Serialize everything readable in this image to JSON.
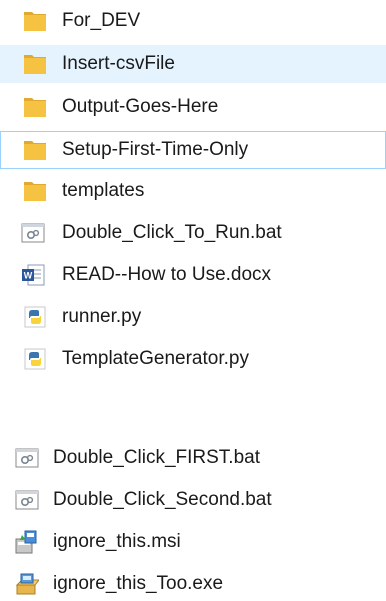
{
  "group1": {
    "items": [
      {
        "label": "For_DEV",
        "icon": "folder-icon"
      },
      {
        "label": "Insert-csvFile",
        "icon": "folder-icon"
      },
      {
        "label": "Output-Goes-Here",
        "icon": "folder-icon"
      },
      {
        "label": "Setup-First-Time-Only",
        "icon": "folder-icon"
      },
      {
        "label": "templates",
        "icon": "folder-icon"
      },
      {
        "label": "Double_Click_To_Run.bat",
        "icon": "batch-file-icon"
      },
      {
        "label": "READ--How to Use.docx",
        "icon": "word-document-icon"
      },
      {
        "label": "runner.py",
        "icon": "python-file-icon"
      },
      {
        "label": "TemplateGenerator.py",
        "icon": "python-file-icon"
      }
    ]
  },
  "group2": {
    "items": [
      {
        "label": "Double_Click_FIRST.bat",
        "icon": "batch-file-icon"
      },
      {
        "label": "Double_Click_Second.bat",
        "icon": "batch-file-icon"
      },
      {
        "label": "ignore_this.msi",
        "icon": "installer-package-icon"
      },
      {
        "label": "ignore_this_Too.exe",
        "icon": "setup-executable-icon"
      }
    ]
  },
  "colors": {
    "folder": "#f5c242",
    "hover_background": "#e5f3ff",
    "focus_border": "#99d1ff",
    "word_blue": "#2b579a",
    "python_blue": "#3a75b0",
    "python_yellow": "#f7d43e"
  }
}
